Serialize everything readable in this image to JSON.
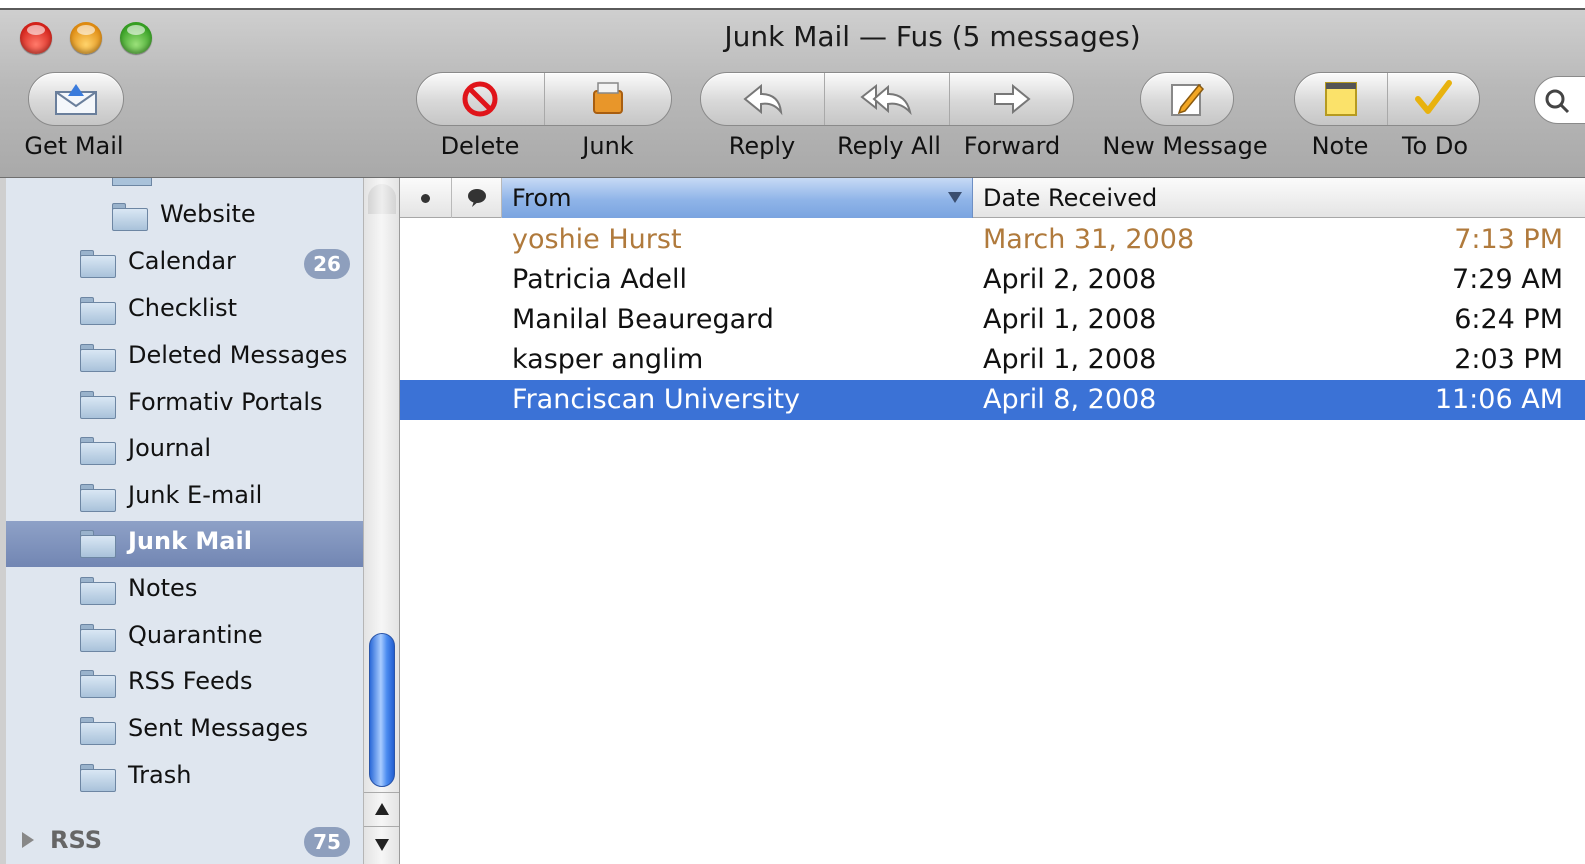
{
  "window": {
    "title": "Junk Mail — Fus (5 messages)"
  },
  "toolbar": {
    "get_mail": "Get Mail",
    "delete": "Delete",
    "junk": "Junk",
    "reply": "Reply",
    "reply_all": "Reply All",
    "forward": "Forward",
    "new_message": "New Message",
    "note": "Note",
    "todo": "To Do"
  },
  "sidebar": {
    "items": [
      {
        "label": "Website",
        "badge": ""
      },
      {
        "label": "Calendar",
        "badge": "26"
      },
      {
        "label": "Checklist",
        "badge": ""
      },
      {
        "label": "Deleted Messages",
        "badge": ""
      },
      {
        "label": "Formativ Portals",
        "badge": ""
      },
      {
        "label": "Journal",
        "badge": ""
      },
      {
        "label": "Junk E-mail",
        "badge": ""
      },
      {
        "label": "Junk Mail",
        "badge": ""
      },
      {
        "label": "Notes",
        "badge": ""
      },
      {
        "label": "Quarantine",
        "badge": ""
      },
      {
        "label": "RSS Feeds",
        "badge": ""
      },
      {
        "label": "Sent Messages",
        "badge": ""
      },
      {
        "label": "Trash",
        "badge": ""
      }
    ],
    "selected": "Junk Mail",
    "rss": {
      "label": "RSS",
      "badge": "75"
    }
  },
  "message_list": {
    "columns": {
      "from": "From",
      "date_received": "Date Received"
    },
    "rows": [
      {
        "from": "yoshie Hurst",
        "date": "March 31, 2008",
        "time": "7:13 PM",
        "state": "junk"
      },
      {
        "from": "Patricia Adell",
        "date": "April 2, 2008",
        "time": "7:29 AM",
        "state": "normal"
      },
      {
        "from": "Manilal Beauregard",
        "date": "April 1, 2008",
        "time": "6:24 PM",
        "state": "normal"
      },
      {
        "from": "kasper anglim",
        "date": "April 1, 2008",
        "time": "2:03 PM",
        "state": "normal"
      },
      {
        "from": "Franciscan University",
        "date": "April 8, 2008",
        "time": "11:06 AM",
        "state": "selected"
      }
    ]
  },
  "colors": {
    "selection": "#3b72d6",
    "sidebar_selection": "#7d90bb",
    "junk_text": "#b07a3c"
  }
}
